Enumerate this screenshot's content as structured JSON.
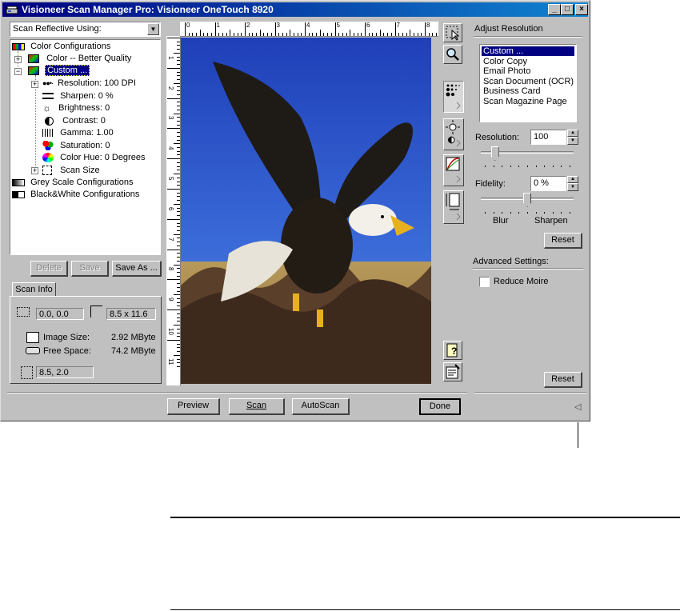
{
  "window": {
    "title": "Visioneer Scan Manager Pro:  Visioneer OneTouch 8920",
    "min_label": "_",
    "max_label": "□",
    "close_label": "×"
  },
  "source_select": {
    "value": "Scan Reflective Using:",
    "arrow": "▼"
  },
  "tree": {
    "color_configs": "Color Configurations",
    "color_better": "Color -- Better Quality",
    "custom": "Custom ...",
    "resolution": "Resolution: 100 DPI",
    "sharpen": "Sharpen: 0 %",
    "brightness": "Brightness: 0",
    "contrast": "Contrast: 0",
    "gamma": "Gamma: 1.00",
    "saturation": "Saturation: 0",
    "color_hue": "Color Hue: 0 Degrees",
    "scan_size": "Scan Size",
    "grey_configs": "Grey Scale Configurations",
    "bw_configs": "Black&White Configurations"
  },
  "config_buttons": {
    "delete": "Delete",
    "save": "Save",
    "save_as": "Save As ..."
  },
  "scan_info": {
    "tab": "Scan Info",
    "origin": "0.0, 0.0",
    "size": "8.5 x 11.6",
    "image_size_label": "Image Size:",
    "image_size_value": "2.92 MByte",
    "free_space_label": "Free Space:",
    "free_space_value": "74.2 MByte",
    "cursor_pos": "8.5, 2.0"
  },
  "ruler": {
    "h_labels": [
      "0",
      "1",
      "2",
      "3",
      "4",
      "5",
      "6",
      "7",
      "8"
    ],
    "v_labels": [
      "1",
      "2",
      "3",
      "4",
      "5",
      "6",
      "7",
      "8",
      "9",
      "10",
      "11"
    ]
  },
  "adjust": {
    "header": "Adjust Resolution",
    "presets": [
      "Custom ...",
      "Color Copy",
      "Email Photo",
      "Scan Document (OCR)",
      "Business Card",
      "Scan Magazine Page"
    ],
    "selected_preset": "Custom ...",
    "resolution_label": "Resolution:",
    "resolution_value": "100",
    "resolution_slider": 0.12,
    "fidelity_label": "Fidelity:",
    "fidelity_value": "0 %",
    "fidelity_slider": 0.5,
    "blur_label": "Blur",
    "sharpen_label": "Sharpen",
    "reset_label": "Reset",
    "advanced_header": "Advanced Settings:",
    "reduce_moire_label": "Reduce Moire",
    "reduce_moire_checked": false,
    "reset2_label": "Reset"
  },
  "bottom": {
    "preview": "Preview",
    "scan": "Scan",
    "autoscan": "AutoScan",
    "done": "Done",
    "collapse_arrow": "◁"
  },
  "colors": {
    "title_start": "#000080",
    "title_end": "#1084d0",
    "sky": "#2a55c8",
    "face": "#c0c0c0"
  }
}
